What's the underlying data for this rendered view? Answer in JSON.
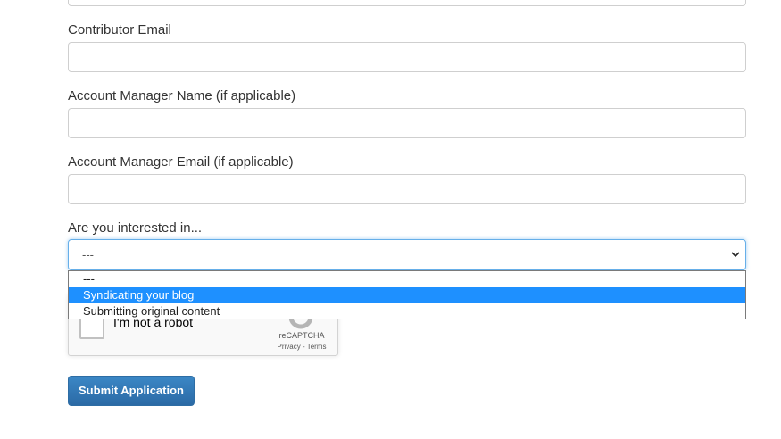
{
  "form": {
    "fields": [
      {
        "label": "Contributor Email",
        "value": ""
      },
      {
        "label": "Account Manager Name (if applicable)",
        "value": ""
      },
      {
        "label": "Account Manager Email (if applicable)",
        "value": ""
      }
    ],
    "interest": {
      "label": "Are you interested in...",
      "selected": "---",
      "options": [
        "---",
        "Syndicating your blog",
        "Submitting original content"
      ],
      "highlighted_option": "Syndicating your blog"
    },
    "recaptcha": {
      "checkbox_label": "I'm not a robot",
      "brand": "reCAPTCHA",
      "links": "Privacy - Terms"
    },
    "submit_label": "Submit Application"
  },
  "colors": {
    "primary_button": "#337ab7",
    "focus_border": "#66afe9",
    "option_highlight": "#1e90ff"
  }
}
